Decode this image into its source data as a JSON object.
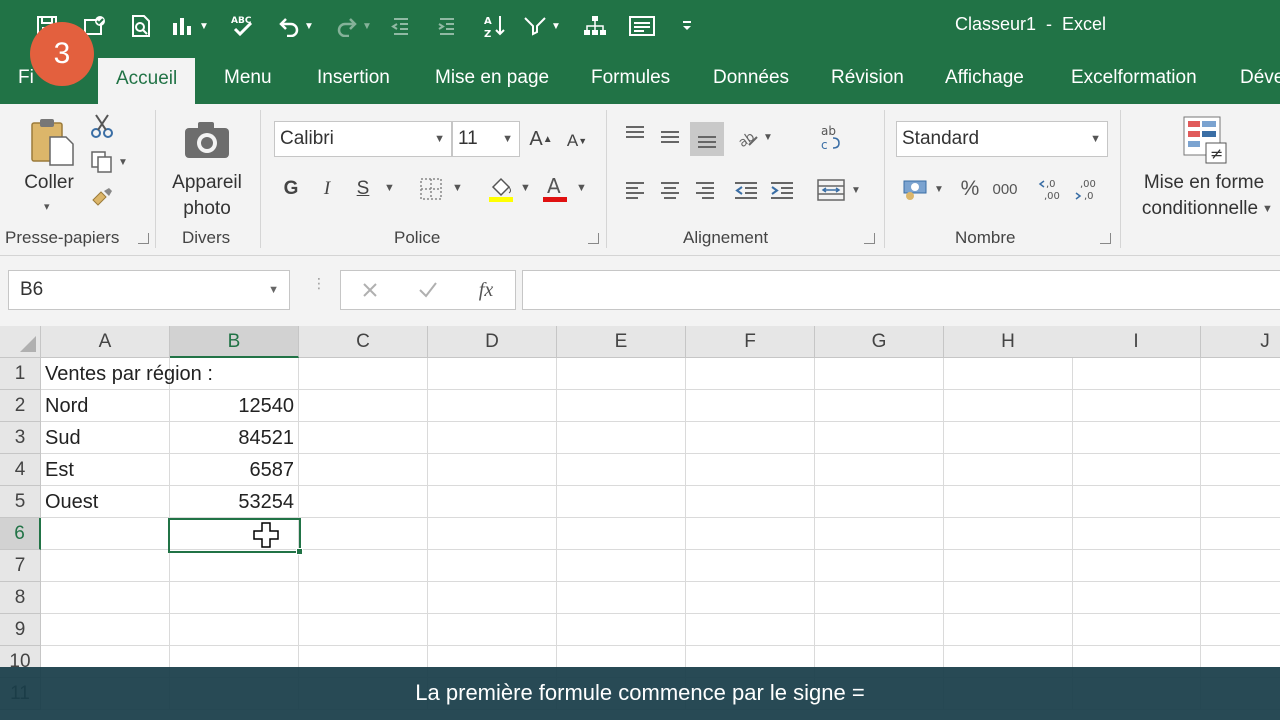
{
  "window": {
    "title": "Classeur1  -  Excel"
  },
  "step_badge": "3",
  "tabs": [
    {
      "label": "Fi"
    },
    {
      "label": "Accueil",
      "active": true
    },
    {
      "label": "Menu"
    },
    {
      "label": "Insertion"
    },
    {
      "label": "Mise en page"
    },
    {
      "label": "Formules"
    },
    {
      "label": "Données"
    },
    {
      "label": "Révision"
    },
    {
      "label": "Affichage"
    },
    {
      "label": "Excelformation"
    },
    {
      "label": "Déve"
    }
  ],
  "ribbon": {
    "clipboard": {
      "paste_label": "Coller",
      "group": "Presse-papiers"
    },
    "divers": {
      "camera_line1": "Appareil",
      "camera_line2": "photo",
      "group": "Divers"
    },
    "font": {
      "name": "Calibri",
      "size": "11",
      "bold": "G",
      "italic": "I",
      "underline": "S",
      "group": "Police"
    },
    "alignment": {
      "group": "Alignement"
    },
    "number": {
      "format": "Standard",
      "group": "Nombre",
      "percent": "%",
      "thousands": "000"
    },
    "styles": {
      "cf_line1": "Mise en forme",
      "cf_line2": "conditionnelle"
    }
  },
  "formula_bar": {
    "name_box": "B6",
    "fx": "fx",
    "value": ""
  },
  "columns": [
    "A",
    "B",
    "C",
    "D",
    "E",
    "F",
    "G",
    "H",
    "I",
    "J"
  ],
  "rows": [
    "1",
    "2",
    "3",
    "4",
    "5",
    "6",
    "7",
    "8",
    "9",
    "10",
    "11"
  ],
  "cells": {
    "A1": "Ventes par région :",
    "A2": "Nord",
    "B2": "12540",
    "A3": "Sud",
    "B3": "84521",
    "A4": "Est",
    "B4": "6587",
    "A5": "Ouest",
    "B5": "53254"
  },
  "selected_cell": "B6",
  "caption": "La première formule commence par le signe ="
}
